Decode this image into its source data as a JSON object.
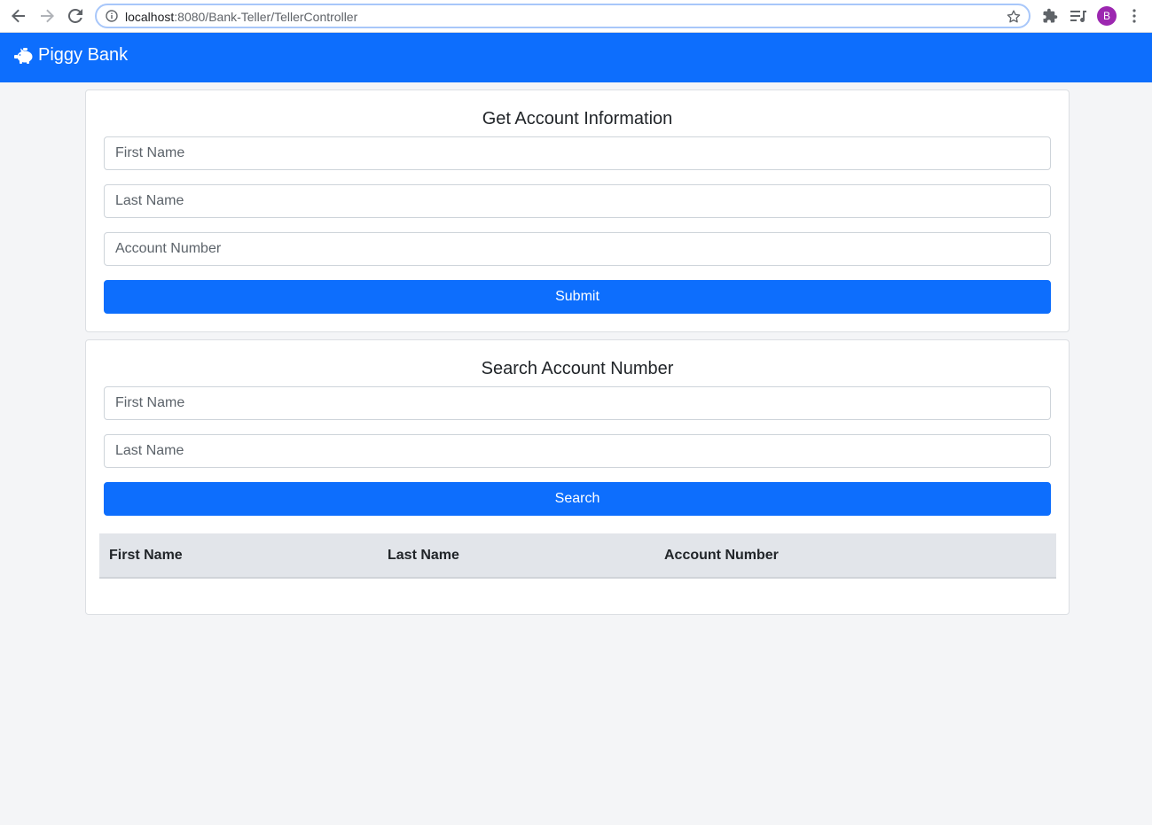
{
  "browser": {
    "url_host": "localhost",
    "url_path": ":8080/Bank-Teller/TellerController",
    "profile_initial": "B"
  },
  "navbar": {
    "brand": "Piggy Bank"
  },
  "account_info": {
    "title": "Get Account Information",
    "first_name_placeholder": "First Name",
    "last_name_placeholder": "Last Name",
    "account_number_placeholder": "Account Number",
    "submit_label": "Submit"
  },
  "search": {
    "title": "Search Account Number",
    "first_name_placeholder": "First Name",
    "last_name_placeholder": "Last Name",
    "search_label": "Search",
    "table": {
      "columns": [
        "First Name",
        "Last Name",
        "Account Number"
      ],
      "rows": []
    }
  },
  "colors": {
    "primary": "#0d6efd",
    "background": "#f4f5f7",
    "table_header": "#e2e5ea",
    "avatar": "#9c27b0"
  }
}
